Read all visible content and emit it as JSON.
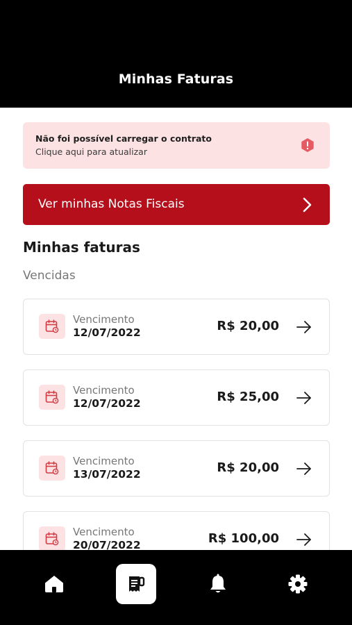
{
  "header": {
    "title": "Minhas Faturas"
  },
  "alert": {
    "title": "Não foi possível carregar o contrato",
    "subtitle": "Clique aqui para atualizar",
    "icon": "warning-hexagon-icon",
    "color": "#e65b63"
  },
  "nf_button": {
    "label": "Ver minhas Notas Fiscais",
    "color": "#b50f1b"
  },
  "section": {
    "title": "Minhas faturas",
    "subtitle": "Vencidas"
  },
  "invoices": [
    {
      "label": "Vencimento",
      "date": "12/07/2022",
      "amount": "R$ 20,00"
    },
    {
      "label": "Vencimento",
      "date": "12/07/2022",
      "amount": "R$ 25,00"
    },
    {
      "label": "Vencimento",
      "date": "13/07/2022",
      "amount": "R$ 20,00"
    },
    {
      "label": "Vencimento",
      "date": "20/07/2022",
      "amount": "R$ 100,00"
    }
  ],
  "tabbar": {
    "items": [
      {
        "name": "home",
        "icon": "home-icon",
        "active": false
      },
      {
        "name": "faturas",
        "icon": "receipt-icon",
        "active": true
      },
      {
        "name": "notificacoes",
        "icon": "bell-icon",
        "active": false
      },
      {
        "name": "configuracoes",
        "icon": "gear-icon",
        "active": false
      }
    ]
  }
}
